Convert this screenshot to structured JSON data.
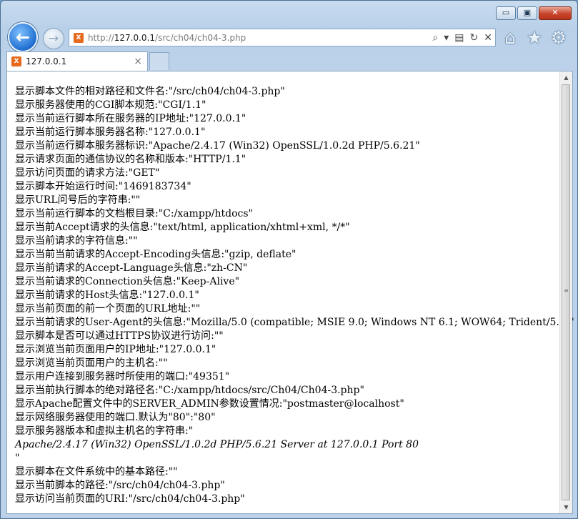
{
  "window_controls": {
    "minimize": "▭",
    "maximize": "▣",
    "close": "✕"
  },
  "nav": {
    "back_icon": "←",
    "forward_icon": "→"
  },
  "address": {
    "prefix": "http://",
    "host": "127.0.0.1",
    "path": "/src/ch04/ch04-3.php",
    "favicon": "X"
  },
  "toolbar": {
    "search_icon": "⌕",
    "dropdown_icon": "▾",
    "compat_icon": "▤",
    "refresh_icon": "↻",
    "stop_icon": "✕",
    "home_icon": "⌂",
    "favorites_icon": "★",
    "tools_icon": "⚙"
  },
  "tab": {
    "title": "127.0.0.1",
    "close": "×"
  },
  "content": {
    "lines": [
      {
        "text": "显示脚本文件的相对路径和文件名:\"/src/ch04/ch04-3.php\""
      },
      {
        "text": "显示服务器使用的CGI脚本规范:\"CGI/1.1\""
      },
      {
        "text": "显示当前运行脚本所在服务器的IP地址:\"127.0.0.1\""
      },
      {
        "text": "显示当前运行脚本服务器名称:\"127.0.0.1\""
      },
      {
        "text": "显示当前运行脚本服务器标识:\"Apache/2.4.17 (Win32) OpenSSL/1.0.2d PHP/5.6.21\""
      },
      {
        "text": "显示请求页面的通信协议的名称和版本:\"HTTP/1.1\""
      },
      {
        "text": "显示访问页面的请求方法:\"GET\""
      },
      {
        "text": "显示脚本开始运行时间:\"1469183734\""
      },
      {
        "text": "显示URL问号后的字符串:\"\""
      },
      {
        "text": "显示当前运行脚本的文档根目录:\"C:/xampp/htdocs\""
      },
      {
        "text": "显示当前Accept请求的头信息:\"text/html, application/xhtml+xml, */*\""
      },
      {
        "text": "显示当前请求的字符信息:\"\""
      },
      {
        "text": "显示当前当前请求的Accept-Encoding头信息:\"gzip, deflate\""
      },
      {
        "text": "显示当前请求的Accept-Language头信息:\"zh-CN\""
      },
      {
        "text": "显示当前请求的Connection头信息:\"Keep-Alive\""
      },
      {
        "text": "显示当前请求的Host头信息:\"127.0.0.1\""
      },
      {
        "text": "显示当前页面的前一个页面的URL地址:\"\""
      },
      {
        "text": "显示当前请求的User-Agent的头信息:\"Mozilla/5.0 (compatible; MSIE 9.0; Windows NT 6.1; WOW64; Trident/5.0)\""
      },
      {
        "text": "显示脚本是否可以通过HTTPS协议进行访问:\"\""
      },
      {
        "text": "显示浏览当前页面用户的IP地址:\"127.0.0.1\""
      },
      {
        "text": "显示浏览当前页面用户的主机名:\"\""
      },
      {
        "text": "显示用户连接到服务器时所使用的端口:\"49351\""
      },
      {
        "text": "显示当前执行脚本的绝对路径名:\"C:/xampp/htdocs/src/Ch04/Ch04-3.php\""
      },
      {
        "text": "显示Apache配置文件中的SERVER_ADMIN参数设置情况:\"postmaster@localhost\""
      },
      {
        "text": "显示网络服务器使用的端口.默认为\"80\":\"80\""
      },
      {
        "text": "显示服务器版本和虚拟主机名的字符串:\""
      },
      {
        "text": "Apache/2.4.17 (Win32) OpenSSL/1.0.2d PHP/5.6.21 Server at 127.0.0.1 Port 80",
        "italic": true
      },
      {
        "text": "\""
      },
      {
        "text": "显示脚本在文件系统中的基本路径:\"\""
      },
      {
        "text": "显示当前脚本的路径:\"/src/ch04/ch04-3.php\""
      },
      {
        "text": "显示访问当前页面的URI:\"/src/ch04/ch04-3.php\""
      }
    ]
  },
  "scrollbar": {
    "up_arrow": "▲",
    "down_arrow": "▼",
    "grip": "≡"
  }
}
